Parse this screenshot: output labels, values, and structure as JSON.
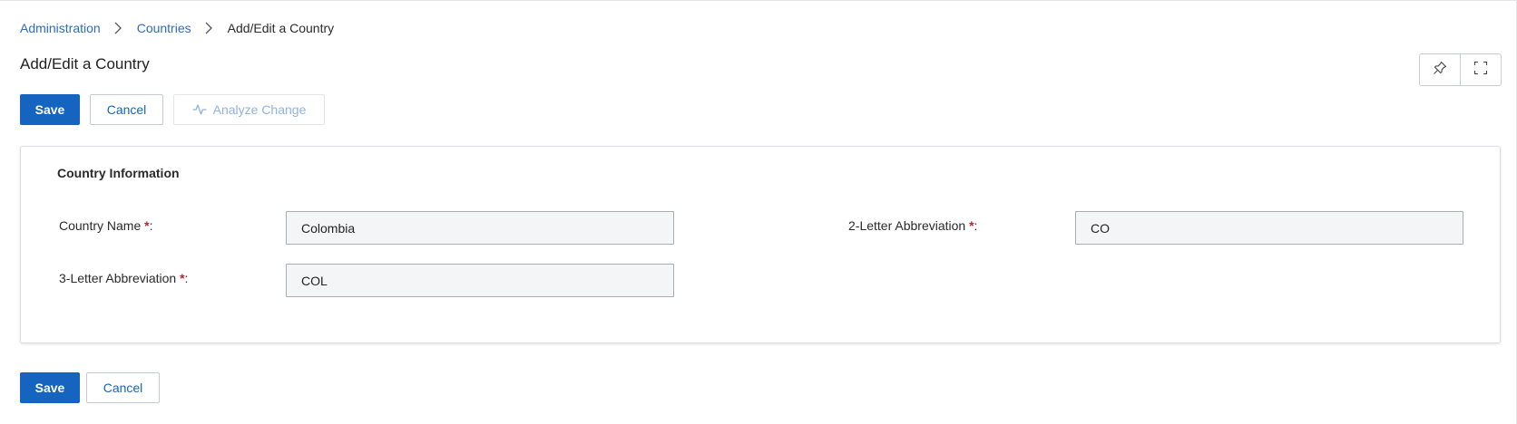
{
  "breadcrumb": {
    "items": [
      "Administration",
      "Countries"
    ],
    "current": "Add/Edit a Country"
  },
  "page": {
    "title": "Add/Edit a Country"
  },
  "corner_tools": {
    "pin_icon": "pin-icon",
    "expand_icon": "expand-icon"
  },
  "toolbar": {
    "save_label": "Save",
    "cancel_label": "Cancel",
    "analyze_label": "Analyze Change",
    "analyze_icon": "activity-icon"
  },
  "form": {
    "section_title": "Country Information",
    "required_marker": "*",
    "country_name": {
      "label": "Country Name ",
      "suffix": ":",
      "value": "Colombia"
    },
    "two_letter": {
      "label": "2-Letter Abbreviation ",
      "suffix": ":",
      "value": "CO"
    },
    "three_letter": {
      "label": "3-Letter Abbreviation ",
      "suffix": ":",
      "value": "COL"
    }
  },
  "footer": {
    "save_label": "Save",
    "cancel_label": "Cancel"
  },
  "colors": {
    "primary": "#1565c0",
    "link": "#2d6bc4",
    "required": "#b3262e",
    "disabled_text": "#8fb3e3"
  }
}
